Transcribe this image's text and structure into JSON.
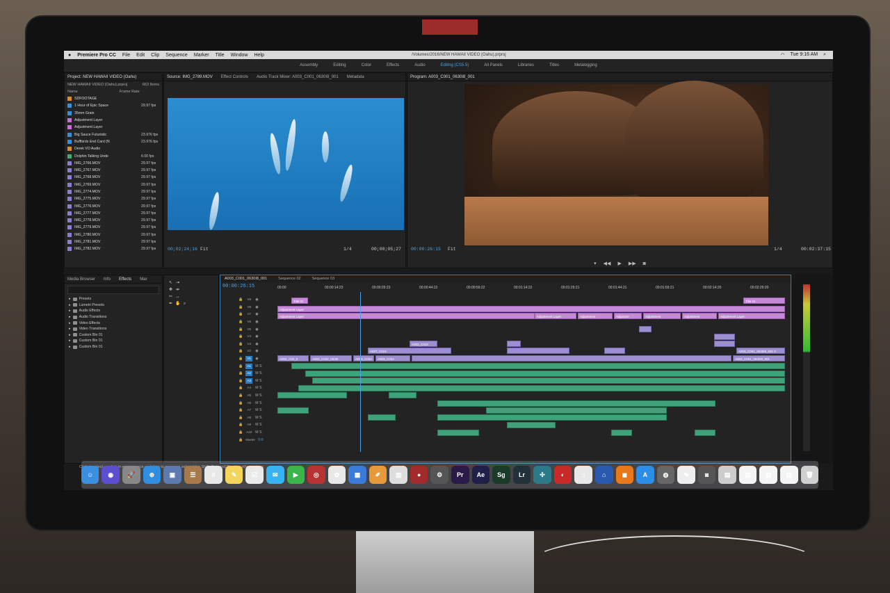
{
  "menubar": {
    "app_name": "Premiere Pro CC",
    "items": [
      "File",
      "Edit",
      "Clip",
      "Sequence",
      "Marker",
      "Title",
      "Window",
      "Help"
    ],
    "file_path": "/Volumes/2016/NEW HAWAII VIDEO (Oahu).prproj",
    "clock": "Tue 9:16 AM"
  },
  "workspaces": {
    "items": [
      "Assembly",
      "Editing",
      "Color",
      "Effects",
      "Audio",
      "Editing (CS5.5)",
      "All Panels",
      "Libraries",
      "Titles",
      "Metalogging"
    ],
    "active": "Editing (CS5.5)"
  },
  "project_panel": {
    "title": "Project: NEW HAWAII VIDEO (Oahu)",
    "file": "NEW HAWAII VIDEO (Oahu).prproj",
    "item_count": "663 Items",
    "col_name": "Name",
    "col_rate": "Frame Rate",
    "rows": [
      {
        "name": "SDFOOTAGE",
        "rate": "",
        "color": "#e08a2e"
      },
      {
        "name": "1 Hour of Epic Space",
        "rate": "29.97 fps",
        "color": "#3b8fd6"
      },
      {
        "name": "35mm Grain",
        "rate": "",
        "color": "#3b8fd6"
      },
      {
        "name": "Adjustment Layer",
        "rate": "",
        "color": "#c76fd6"
      },
      {
        "name": "Adjustment Layer",
        "rate": "",
        "color": "#c76fd6"
      },
      {
        "name": "Big Sauce Futuristic",
        "rate": "23.976 fps",
        "color": "#3b8fd6"
      },
      {
        "name": "Buffbirds End Card (N",
        "rate": "23.976 fps",
        "color": "#3b8fd6"
      },
      {
        "name": "Derek VO Audio",
        "rate": "",
        "color": "#e08a2e"
      },
      {
        "name": "Dolphin Talking Unde",
        "rate": "6.00 fps",
        "color": "#3fae6f"
      },
      {
        "name": "IMG_2766.MOV",
        "rate": "29.97 fps",
        "color": "#8a7fd0"
      },
      {
        "name": "IMG_2767.MOV",
        "rate": "29.97 fps",
        "color": "#8a7fd0"
      },
      {
        "name": "IMG_2768.MOV",
        "rate": "29.97 fps",
        "color": "#8a7fd0"
      },
      {
        "name": "IMG_2769.MOV",
        "rate": "29.97 fps",
        "color": "#8a7fd0"
      },
      {
        "name": "IMG_2774.MOV",
        "rate": "29.97 fps",
        "color": "#8a7fd0"
      },
      {
        "name": "IMG_2775.MOV",
        "rate": "29.97 fps",
        "color": "#8a7fd0"
      },
      {
        "name": "IMG_2776.MOV",
        "rate": "29.97 fps",
        "color": "#8a7fd0"
      },
      {
        "name": "IMG_2777.MOV",
        "rate": "29.97 fps",
        "color": "#8a7fd0"
      },
      {
        "name": "IMG_2778.MOV",
        "rate": "29.97 fps",
        "color": "#8a7fd0"
      },
      {
        "name": "IMG_2779.MOV",
        "rate": "29.97 fps",
        "color": "#8a7fd0"
      },
      {
        "name": "IMG_2780.MOV",
        "rate": "29.97 fps",
        "color": "#8a7fd0"
      },
      {
        "name": "IMG_2781.MOV",
        "rate": "29.97 fps",
        "color": "#8a7fd0"
      },
      {
        "name": "IMG_2782.MOV",
        "rate": "29.97 fps",
        "color": "#8a7fd0"
      }
    ]
  },
  "source_monitor": {
    "tabs": [
      "Source: IMG_2789.MOV",
      "Effect Controls",
      "Audio Track Mixer: A003_C001_0630I8_001",
      "Metadata"
    ],
    "timecode_in": "00;02;24;16",
    "fit": "Fit",
    "scale": "1/4",
    "timecode_dur": "00;00;05;27"
  },
  "program_monitor": {
    "title": "Program: A003_C001_0630I8_001",
    "timecode_in": "00:00:26:15",
    "fit": "Fit",
    "scale": "1/4",
    "timecode_dur": "00:02:37:15"
  },
  "effects_panel": {
    "tabs": [
      "Media Browser",
      "Info",
      "Effects",
      "Mar"
    ],
    "items": [
      "Presets",
      "Lumetri Presets",
      "Audio Effects",
      "Audio Transitions",
      "Video Effects",
      "Video Transitions",
      "Custom Bin 01",
      "Custom Bin 01",
      "Custom Bin 01"
    ]
  },
  "timeline": {
    "tabs": [
      "A003_C001_0630I8_001",
      "Sequence 02",
      "Sequence 03"
    ],
    "timecode": "00:00:26:15",
    "ruler": [
      "00:00",
      "00:00:14:23",
      "00:00:29:23",
      "00:00:44:22",
      "00:00:59:22",
      "00:01:14:22",
      "00:01:29:21",
      "00:01:44:21",
      "00:01:59:21",
      "00:02:14:20",
      "00:02:29:20"
    ],
    "tracks": [
      "V9",
      "V8",
      "V7",
      "V6",
      "V5",
      "V4",
      "V3",
      "V2",
      "V1",
      "A1",
      "A2",
      "A3",
      "A4",
      "A5",
      "A6",
      "A7",
      "A8",
      "A9",
      "A10",
      "Master"
    ],
    "master_level": "0.0",
    "clips": {
      "title01_a": "Title 01",
      "title01_b": "Title 01",
      "adj1": "Adjustment Layer",
      "adj2": "Adjustment Layer",
      "adj3": "Adjustment Layer",
      "adj4": "Adjustment",
      "adj5": "Adjustme",
      "adj6": "Adjustment",
      "adj7": "Adjustment",
      "adj8": "Adjustment Layer",
      "v1a": "A003_C02_0",
      "v1b": "A003_C032_0630I",
      "v1c": "A003_C024",
      "v1d": "A003_C024",
      "v1e": "A003_C001_0630I8_001",
      "v2a": "A003_C024",
      "v2b": "A007_C024",
      "v3a": "A003_C001_0630I8_001 0"
    }
  },
  "status_text": "Click to select, or click in empty space and drag to marquee select. Use Shift, Opt, and Cmd for other options.",
  "dock": {
    "icons": [
      {
        "name": "finder",
        "glyph": "☺",
        "color": "#3a8fe0"
      },
      {
        "name": "siri",
        "glyph": "◉",
        "color": "#5b4fd0"
      },
      {
        "name": "launchpad",
        "glyph": "🚀",
        "color": "#888"
      },
      {
        "name": "safari",
        "glyph": "⊕",
        "color": "#2f8ee0"
      },
      {
        "name": "photos-preview",
        "glyph": "▣",
        "color": "#5a7ab0"
      },
      {
        "name": "contacts",
        "glyph": "☰",
        "color": "#a87a4a"
      },
      {
        "name": "calendar",
        "glyph": "8",
        "color": "#e8e8e8"
      },
      {
        "name": "notes",
        "glyph": "✎",
        "color": "#f2d55a"
      },
      {
        "name": "reminders",
        "glyph": "☑",
        "color": "#eaeaea"
      },
      {
        "name": "messages",
        "glyph": "✉",
        "color": "#35b3f2"
      },
      {
        "name": "facetime",
        "glyph": "▶",
        "color": "#3ab54a"
      },
      {
        "name": "photo-booth",
        "glyph": "◎",
        "color": "#b83232"
      },
      {
        "name": "photos",
        "glyph": "✿",
        "color": "#e8e8e8"
      },
      {
        "name": "keynote",
        "glyph": "▦",
        "color": "#3a7ad8"
      },
      {
        "name": "pages",
        "glyph": "✐",
        "color": "#e89a3a"
      },
      {
        "name": "numbers",
        "glyph": "▥",
        "color": "#ddd"
      },
      {
        "name": "dvd-player",
        "glyph": "●",
        "color": "#a32a2a"
      },
      {
        "name": "system-preferences",
        "glyph": "⚙",
        "color": "#555"
      },
      {
        "name": "premiere-pro",
        "glyph": "Pr",
        "color": "#2a1a4a"
      },
      {
        "name": "after-effects",
        "glyph": "Ae",
        "color": "#1f1f4a"
      },
      {
        "name": "speedgrade",
        "glyph": "Sg",
        "color": "#1a3a2a"
      },
      {
        "name": "lightroom",
        "glyph": "Lr",
        "color": "#22303a"
      },
      {
        "name": "colors",
        "glyph": "✣",
        "color": "#2a7a8a"
      },
      {
        "name": "creative-cloud",
        "glyph": "◐",
        "color": "#c82a2a"
      },
      {
        "name": "itunes",
        "glyph": "♫",
        "color": "#e8e8e8"
      },
      {
        "name": "keynote-2",
        "glyph": "⌂",
        "color": "#2a5ab0"
      },
      {
        "name": "ibooks",
        "glyph": "◼",
        "color": "#e8781a"
      },
      {
        "name": "app-store",
        "glyph": "A",
        "color": "#2a8ee8"
      },
      {
        "name": "disk-utility",
        "glyph": "◍",
        "color": "#666"
      },
      {
        "name": "text-edit",
        "glyph": "✎",
        "color": "#eee"
      },
      {
        "name": "camera",
        "glyph": "◙",
        "color": "#555"
      },
      {
        "name": "image-capture",
        "glyph": "▤",
        "color": "#ccc"
      },
      {
        "name": "document-1",
        "glyph": "▤",
        "color": "#f4f4f4"
      },
      {
        "name": "document-2",
        "glyph": "▤",
        "color": "#f4f4f4"
      },
      {
        "name": "document-3",
        "glyph": "▤",
        "color": "#f4f4f4"
      },
      {
        "name": "trash",
        "glyph": "🗑",
        "color": "#cfcfcf"
      }
    ]
  },
  "colors": {
    "accent": "#4aa3e8",
    "adjustment_clip": "#c58ad7",
    "video_clip": "#9d8fcf",
    "audio_clip": "#3fa27a"
  }
}
